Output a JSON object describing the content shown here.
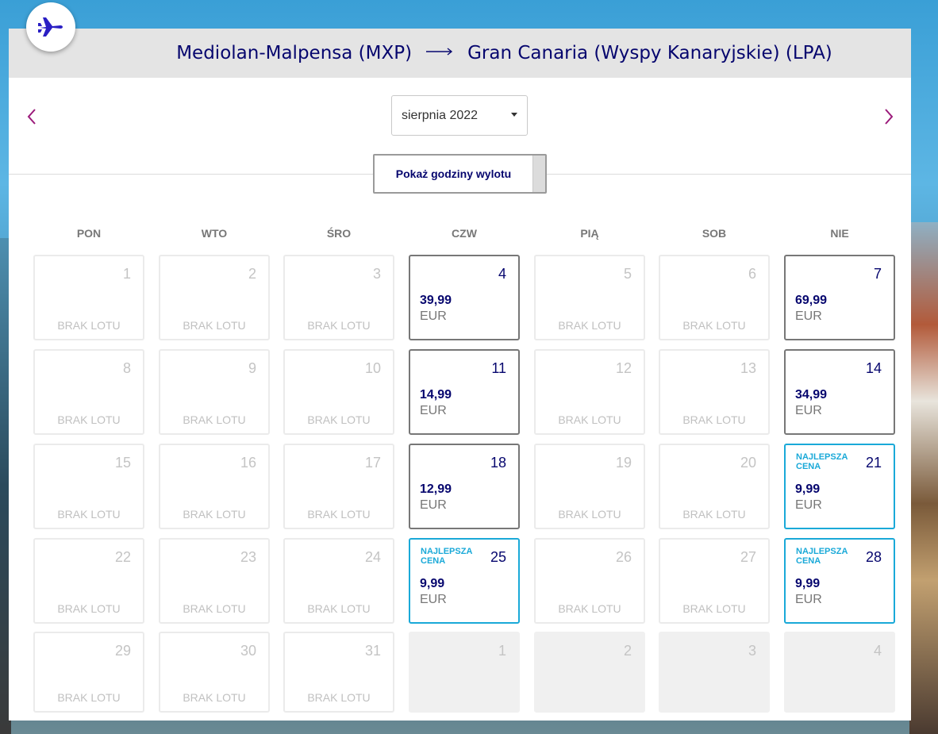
{
  "header": {
    "origin": "Mediolan-Malpensa (MXP)",
    "destination": "Gran Canaria (Wyspy Kanaryjskie) (LPA)",
    "plane_icon": "plane-icon",
    "arrow_icon": "long-arrow-right-icon"
  },
  "nav": {
    "prev_icon": "chevron-left-icon",
    "next_icon": "chevron-right-icon",
    "accent_color": "#9b1a7a"
  },
  "month_select": {
    "value": "sierpnia 2022"
  },
  "toggle": {
    "label": "Pokaż godziny wylotu"
  },
  "weekdays": [
    "PON",
    "WTO",
    "ŚRO",
    "CZW",
    "PIĄ",
    "SOB",
    "NIE"
  ],
  "labels": {
    "no_flight": "BRAK LOTU",
    "best_price": "NAJLEPSZA CENA",
    "currency": "EUR"
  },
  "colors": {
    "brand_navy": "#06066e",
    "best_price_blue": "#1aa9d8"
  },
  "calendar": [
    {
      "day": "1",
      "status": "none"
    },
    {
      "day": "2",
      "status": "none"
    },
    {
      "day": "3",
      "status": "none"
    },
    {
      "day": "4",
      "status": "flight",
      "price": "39,99"
    },
    {
      "day": "5",
      "status": "none"
    },
    {
      "day": "6",
      "status": "none"
    },
    {
      "day": "7",
      "status": "flight",
      "price": "69,99"
    },
    {
      "day": "8",
      "status": "none"
    },
    {
      "day": "9",
      "status": "none"
    },
    {
      "day": "10",
      "status": "none"
    },
    {
      "day": "11",
      "status": "flight",
      "price": "14,99"
    },
    {
      "day": "12",
      "status": "none"
    },
    {
      "day": "13",
      "status": "none"
    },
    {
      "day": "14",
      "status": "flight",
      "price": "34,99"
    },
    {
      "day": "15",
      "status": "none"
    },
    {
      "day": "16",
      "status": "none"
    },
    {
      "day": "17",
      "status": "none"
    },
    {
      "day": "18",
      "status": "flight",
      "price": "12,99"
    },
    {
      "day": "19",
      "status": "none"
    },
    {
      "day": "20",
      "status": "none"
    },
    {
      "day": "21",
      "status": "best",
      "price": "9,99"
    },
    {
      "day": "22",
      "status": "none"
    },
    {
      "day": "23",
      "status": "none"
    },
    {
      "day": "24",
      "status": "none"
    },
    {
      "day": "25",
      "status": "best",
      "price": "9,99"
    },
    {
      "day": "26",
      "status": "none"
    },
    {
      "day": "27",
      "status": "none"
    },
    {
      "day": "28",
      "status": "best",
      "price": "9,99"
    },
    {
      "day": "29",
      "status": "none"
    },
    {
      "day": "30",
      "status": "none"
    },
    {
      "day": "31",
      "status": "none"
    },
    {
      "day": "1",
      "status": "outside"
    },
    {
      "day": "2",
      "status": "outside"
    },
    {
      "day": "3",
      "status": "outside"
    },
    {
      "day": "4",
      "status": "outside"
    }
  ]
}
